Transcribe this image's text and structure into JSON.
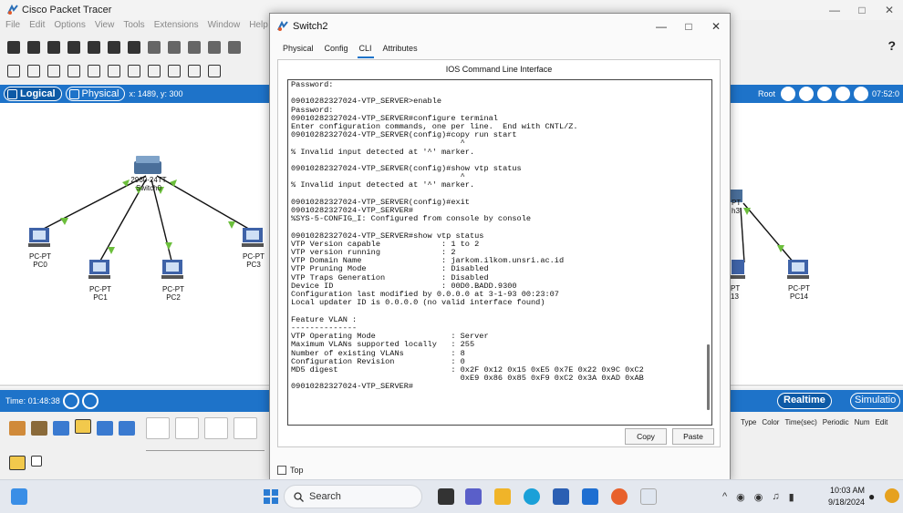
{
  "app": {
    "title": "Cisco Packet Tracer",
    "menu": [
      "File",
      "Edit",
      "Options",
      "View",
      "Tools",
      "Extensions",
      "Window",
      "Help"
    ],
    "help_mark": "?"
  },
  "navbar": {
    "logical_label": "Logical",
    "physical_label": "Physical",
    "coords": "x: 1489, y: 300",
    "root_label": "Root",
    "clock_readout": "07:52:0"
  },
  "topology": {
    "switch_label_top": "2960-24TT",
    "switch_label": "Switch0",
    "right_device_partial_1": "PT",
    "right_device_partial_2": "h3",
    "devices": [
      {
        "type": "PC-PT",
        "name": "PC0"
      },
      {
        "type": "PC-PT",
        "name": "PC1"
      },
      {
        "type": "PC-PT",
        "name": "PC2"
      },
      {
        "type": "PC-PT",
        "name": "PC3"
      },
      {
        "type": "PT",
        "name": "13"
      },
      {
        "type": "PC-PT",
        "name": "PC14"
      }
    ]
  },
  "statusbar": {
    "time_label": "Time: 01:48:38",
    "realtime_label": "Realtime",
    "simulation_label": "Simulatio"
  },
  "pdu_table_headers": [
    "Type",
    "Color",
    "Time(sec)",
    "Periodic",
    "Num",
    "Edit"
  ],
  "dialog": {
    "title": "Switch2",
    "tabs": [
      "Physical",
      "Config",
      "CLI",
      "Attributes"
    ],
    "active_tab": "CLI",
    "panel_header": "IOS Command Line Interface",
    "cli_lines": [
      "Password:",
      "",
      "09010282327024-VTP_SERVER>enable",
      "Password:",
      "09010282327024-VTP_SERVER#configure terminal",
      "Enter configuration commands, one per line.  End with CNTL/Z.",
      "09010282327024-VTP_SERVER(config)#copy run start",
      "                                    ^",
      "% Invalid input detected at '^' marker.",
      "",
      "09010282327024-VTP_SERVER(config)#show vtp status",
      "                                    ^",
      "% Invalid input detected at '^' marker.",
      "",
      "09010282327024-VTP_SERVER(config)#exit",
      "09010282327024-VTP_SERVER#",
      "%SYS-5-CONFIG_I: Configured from console by console",
      "",
      "09010282327024-VTP_SERVER#show vtp status",
      "VTP Version capable             : 1 to 2",
      "VTP version running             : 2",
      "VTP Domain Name                 : jarkom.ilkom.unsri.ac.id",
      "VTP Pruning Mode                : Disabled",
      "VTP Traps Generation            : Disabled",
      "Device ID                       : 00D0.BADD.9300",
      "Configuration last modified by 0.0.0.0 at 3-1-93 00:23:07",
      "Local updater ID is 0.0.0.0 (no valid interface found)",
      "",
      "Feature VLAN :",
      "--------------",
      "VTP Operating Mode                : Server",
      "Maximum VLANs supported locally   : 255",
      "Number of existing VLANs          : 8",
      "Configuration Revision            : 0",
      "MD5 digest                        : 0x2F 0x12 0x15 0xE5 0x7E 0x22 0x9C 0xC2",
      "                                    0xE9 0x86 0x85 0xF9 0xC2 0x3A 0xAD 0xAB",
      "09010282327024-VTP_SERVER#"
    ],
    "copy_label": "Copy",
    "paste_label": "Paste",
    "top_label": "Top"
  },
  "taskbar": {
    "search_placeholder": "Search",
    "clock_time": "10:03 AM",
    "clock_date": "9/18/2024"
  },
  "colors": {
    "nav_blue": "#1e73c9",
    "link_green": "#6cbf3c",
    "link_black": "#111111"
  }
}
